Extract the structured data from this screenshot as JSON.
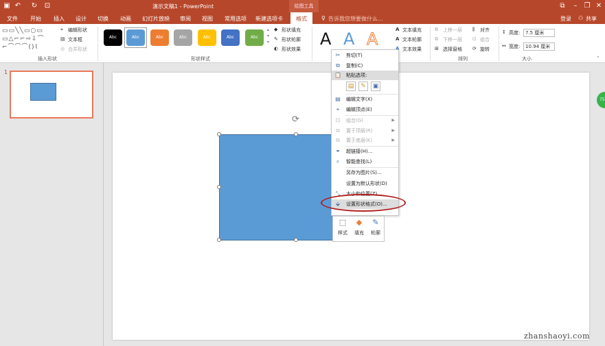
{
  "window": {
    "title": "演示文稿1 - PowerPoint",
    "context_tool": "绘图工具",
    "tell_me": "告诉我您想要做什么...",
    "login": "登录",
    "share": "共享"
  },
  "tabs": [
    {
      "label": "文件"
    },
    {
      "label": "开始"
    },
    {
      "label": "插入"
    },
    {
      "label": "设计"
    },
    {
      "label": "切换"
    },
    {
      "label": "动画"
    },
    {
      "label": "幻灯片放映"
    },
    {
      "label": "审阅"
    },
    {
      "label": "视图"
    },
    {
      "label": "常用选项"
    },
    {
      "label": "新建选项卡"
    },
    {
      "label": "格式"
    }
  ],
  "ribbon": {
    "insert_shapes": {
      "edit_shape": "编辑形状",
      "text_box": "文本框",
      "merge_shapes": "合并形状",
      "group_label": "插入形状"
    },
    "shape_styles": {
      "swatches": [
        {
          "label": "Abc",
          "color": "#000000"
        },
        {
          "label": "Abc",
          "color": "#5b9bd5"
        },
        {
          "label": "Abc",
          "color": "#ed7d31"
        },
        {
          "label": "Abc",
          "color": "#a5a5a5"
        },
        {
          "label": "Abc",
          "color": "#ffc000"
        },
        {
          "label": "Abc",
          "color": "#4472c4"
        },
        {
          "label": "Abc",
          "color": "#70ad47"
        }
      ],
      "fill": "形状填充",
      "outline": "形状轮廓",
      "effects": "形状效果",
      "group_label": "形状样式"
    },
    "wordart": {
      "sample": "A",
      "text_fill": "文本填充",
      "text_outline": "文本轮廓",
      "text_effects": "文本效果"
    },
    "arrange": {
      "bring_forward": "上移一层",
      "send_backward": "下移一层",
      "selection_pane": "选择窗格",
      "align": "对齐",
      "group": "组合",
      "rotate": "旋转",
      "group_label": "排列"
    },
    "size": {
      "height_label": "高度:",
      "height_value": "7.5 厘米",
      "width_label": "宽度:",
      "width_value": "10.94 厘米",
      "group_label": "大小"
    }
  },
  "slides_pane": {
    "slide_number": "1"
  },
  "context_menu": {
    "items": [
      {
        "label": "剪切(T)",
        "icon": "scissors-icon",
        "disabled": false
      },
      {
        "label": "复制(C)",
        "icon": "copy-icon",
        "disabled": false
      },
      {
        "label": "粘贴选项:",
        "icon": "paste-icon",
        "disabled": false
      },
      {
        "label": "编辑文字(X)",
        "icon": "edit-text-icon",
        "disabled": false
      },
      {
        "label": "编辑顶点(E)",
        "icon": "edit-points-icon",
        "disabled": false
      },
      {
        "label": "组合(G)",
        "icon": "group-icon",
        "disabled": true
      },
      {
        "label": "置于顶层(R)",
        "icon": "bring-front-icon",
        "disabled": true
      },
      {
        "label": "置于底层(K)",
        "icon": "send-back-icon",
        "disabled": true
      },
      {
        "label": "超链接(H)...",
        "icon": "hyperlink-icon",
        "disabled": false
      },
      {
        "label": "智能查找(L)",
        "icon": "smart-lookup-icon",
        "disabled": false
      },
      {
        "label": "另存为图片(S)...",
        "icon": "",
        "disabled": false
      },
      {
        "label": "设置为默认形状(D)",
        "icon": "",
        "disabled": false
      },
      {
        "label": "大小和位置(Z)...",
        "icon": "size-position-icon",
        "disabled": false
      },
      {
        "label": "设置形状格式(O)...",
        "icon": "format-shape-icon",
        "disabled": false
      }
    ]
  },
  "mini_toolbar": {
    "style": "样式",
    "fill": "填充",
    "outline": "轮廓"
  },
  "side_badge": "75",
  "watermark": "zhanshaoyi.com"
}
